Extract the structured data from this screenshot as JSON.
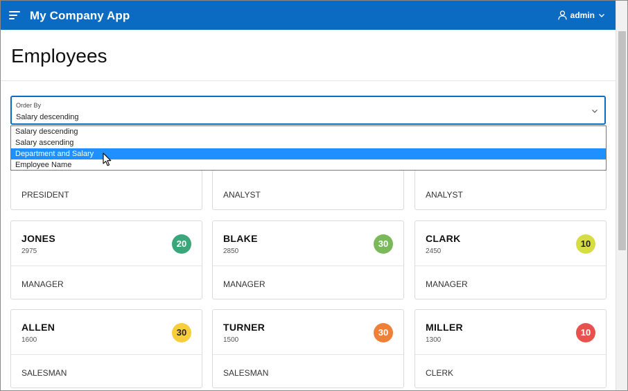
{
  "header": {
    "app_title": "My Company App",
    "user_name": "admin"
  },
  "page": {
    "title": "Employees"
  },
  "order_by": {
    "label": "Order By",
    "value": "Salary descending",
    "options": [
      {
        "label": "Salary descending",
        "highlighted": false
      },
      {
        "label": "Salary ascending",
        "highlighted": false
      },
      {
        "label": "Department and Salary",
        "highlighted": true
      },
      {
        "label": "Employee Name",
        "highlighted": false
      }
    ]
  },
  "partial_cards": [
    {
      "job": "PRESIDENT"
    },
    {
      "job": "ANALYST"
    },
    {
      "job": "ANALYST"
    }
  ],
  "cards": [
    {
      "name": "JONES",
      "salary": "2975",
      "dept": "20",
      "job": "MANAGER",
      "badge_color": "#3aa77a",
      "badge_text_color": "#ffffff"
    },
    {
      "name": "BLAKE",
      "salary": "2850",
      "dept": "30",
      "job": "MANAGER",
      "badge_color": "#7ab85a",
      "badge_text_color": "#ffffff"
    },
    {
      "name": "CLARK",
      "salary": "2450",
      "dept": "10",
      "job": "MANAGER",
      "badge_color": "#d6dd44",
      "badge_text_color": "#222222"
    },
    {
      "name": "ALLEN",
      "salary": "1600",
      "dept": "30",
      "job": "SALESMAN",
      "badge_color": "#f7cd3c",
      "badge_text_color": "#222222"
    },
    {
      "name": "TURNER",
      "salary": "1500",
      "dept": "30",
      "job": "SALESMAN",
      "badge_color": "#ee8038",
      "badge_text_color": "#ffffff"
    },
    {
      "name": "MILLER",
      "salary": "1300",
      "dept": "10",
      "job": "CLERK",
      "badge_color": "#e8524e",
      "badge_text_color": "#ffffff"
    }
  ],
  "colors": {
    "header_bg": "#0b6bc2",
    "select_border": "#0b6bc2",
    "option_highlight": "#1e90ff"
  },
  "icons": {
    "menu": "hamburger-icon",
    "user": "user-icon",
    "chevron": "chevron-down-icon",
    "cursor": "mouse-cursor-icon"
  }
}
